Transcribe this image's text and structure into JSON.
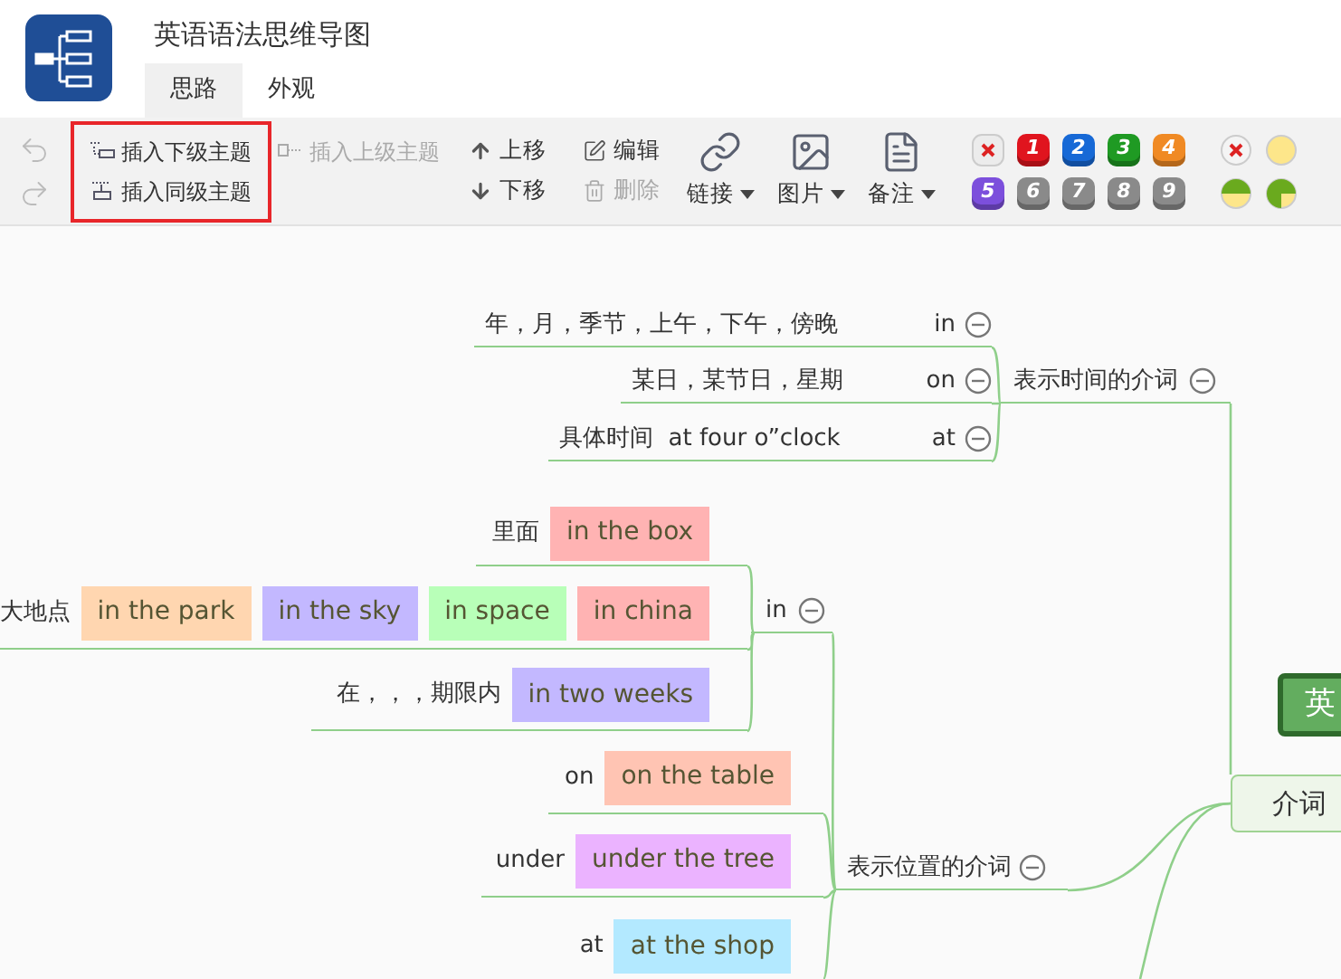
{
  "app": {
    "title": "英语语法思维导图"
  },
  "tabs": [
    {
      "label": "思路",
      "selected": true
    },
    {
      "label": "外观",
      "selected": false
    }
  ],
  "history": [
    {
      "kind": "undo",
      "disabled": true
    },
    {
      "kind": "redo",
      "disabled": true
    }
  ],
  "insert_group": {
    "highlighted": true,
    "buttons": [
      {
        "kind": "child",
        "label": "插入下级主题",
        "disabled": false
      },
      {
        "kind": "sibling",
        "label": "插入同级主题",
        "disabled": false
      }
    ]
  },
  "insert_parent": {
    "label": "插入上级主题",
    "disabled": true
  },
  "edit_buttons": [
    {
      "kind": "up",
      "label": "上移",
      "disabled": false
    },
    {
      "kind": "down",
      "label": "下移",
      "disabled": false
    },
    {
      "kind": "edit",
      "label": "编辑",
      "disabled": false
    },
    {
      "kind": "delete",
      "label": "删除",
      "disabled": true
    }
  ],
  "menus": [
    {
      "kind": "link",
      "label": "链接"
    },
    {
      "kind": "image",
      "label": "图片"
    },
    {
      "kind": "note",
      "label": "备注"
    }
  ],
  "priorities": [
    {
      "kind": "clear"
    },
    {
      "kind": "number",
      "label": "1",
      "color": "#e0141e"
    },
    {
      "kind": "number",
      "label": "2",
      "color": "#1769d6"
    },
    {
      "kind": "number",
      "label": "3",
      "color": "#1f9a23"
    },
    {
      "kind": "number",
      "label": "4",
      "color": "#f08a24"
    },
    {
      "kind": "number",
      "label": "5",
      "color": "#7c4fdc"
    },
    {
      "kind": "number",
      "label": "6",
      "color": "#8a8a8a"
    },
    {
      "kind": "number",
      "label": "7",
      "color": "#8a8a8a"
    },
    {
      "kind": "number",
      "label": "8",
      "color": "#8a8a8a"
    },
    {
      "kind": "number",
      "label": "9",
      "color": "#8a8a8a"
    }
  ],
  "progress": [
    {
      "kind": "clear"
    },
    {
      "kind": "empty"
    },
    {
      "kind": "half"
    },
    {
      "kind": "most"
    }
  ],
  "mindmap": {
    "root": {
      "label": "英"
    },
    "main_topic": {
      "label": "介词"
    },
    "branches": [
      {
        "label": "表示时间的介词",
        "expanded": true,
        "children": [
          {
            "label": "in",
            "expanded": true,
            "note": "年，月，季节，上午，下午，傍晚"
          },
          {
            "label": "on",
            "expanded": true,
            "note": "某日，某节日，星期"
          },
          {
            "label": "at",
            "expanded": true,
            "note": "具体时间  at four o”clock"
          }
        ]
      },
      {
        "label": "表示位置的介词",
        "expanded": true,
        "children": [
          {
            "label": "in",
            "expanded": true,
            "children": [
              {
                "label": "里面",
                "tags": [
                  {
                    "text": "in the box",
                    "color": "#ffb3b3"
                  }
                ]
              },
              {
                "label": "大地点",
                "tags": [
                  {
                    "text": "in the park",
                    "color": "#ffd6b0"
                  },
                  {
                    "text": "in the sky",
                    "color": "#c3b8ff"
                  },
                  {
                    "text": "in space",
                    "color": "#b8ffb8"
                  },
                  {
                    "text": "in china",
                    "color": "#ffb3b3"
                  }
                ]
              },
              {
                "label": "在，，，期限内",
                "tags": [
                  {
                    "text": "in two weeks",
                    "color": "#c3b8ff"
                  }
                ]
              }
            ]
          },
          {
            "label": "on",
            "tags": [
              {
                "text": "on the table",
                "color": "#ffc4b3"
              }
            ]
          },
          {
            "label": "under",
            "tags": [
              {
                "text": "under the tree",
                "color": "#ebb3ff"
              }
            ]
          },
          {
            "label": "at",
            "tags": [
              {
                "text": "at the shop",
                "color": "#b3e9ff"
              }
            ]
          }
        ]
      }
    ]
  }
}
